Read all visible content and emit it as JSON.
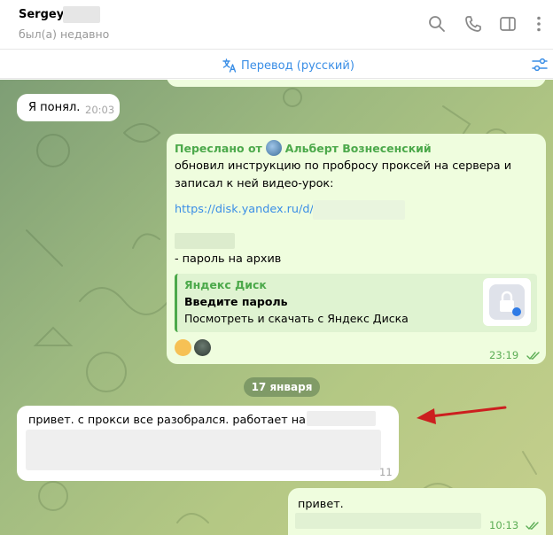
{
  "header": {
    "contact_name": "Sergey",
    "status": "был(а) недавно",
    "icons": [
      "search-icon",
      "phone-icon",
      "sidebar-icon",
      "more-icon"
    ]
  },
  "translation": {
    "label": "Перевод (русский)",
    "icon": "translate-icon",
    "settings_icon": "settings-icon"
  },
  "messages": [
    {
      "direction": "in",
      "text": "Я понял.",
      "time": "20:03"
    },
    {
      "direction": "out",
      "forwarded_prefix": "Переслано от",
      "forwarded_from": "Альберт Вознесенский",
      "text": "обновил инструкцию по пробросу проксей на сервера и записал к ней видео-урок:",
      "link": "https://disk.yandex.ru/d/A",
      "password_note": "- пароль на архив",
      "preview": {
        "site": "Яндекс Диск",
        "title": "Введите пароль",
        "description": "Посмотреть и скачать с Яндекс Диска"
      },
      "time": "23:19",
      "status": "read"
    },
    {
      "direction": "in",
      "text": "привет. с прокси все разобрался. работает на ура.",
      "time": "11"
    },
    {
      "direction": "out",
      "text": "привет.",
      "time": "10:13",
      "status": "read"
    }
  ],
  "date_separator": "17 января",
  "colors": {
    "accent": "#3a8ee6",
    "outgoing_bubble": "#effdde",
    "incoming_bubble": "#ffffff",
    "forward_green": "#4ca94b",
    "annotation_arrow": "#cc1f1f"
  }
}
